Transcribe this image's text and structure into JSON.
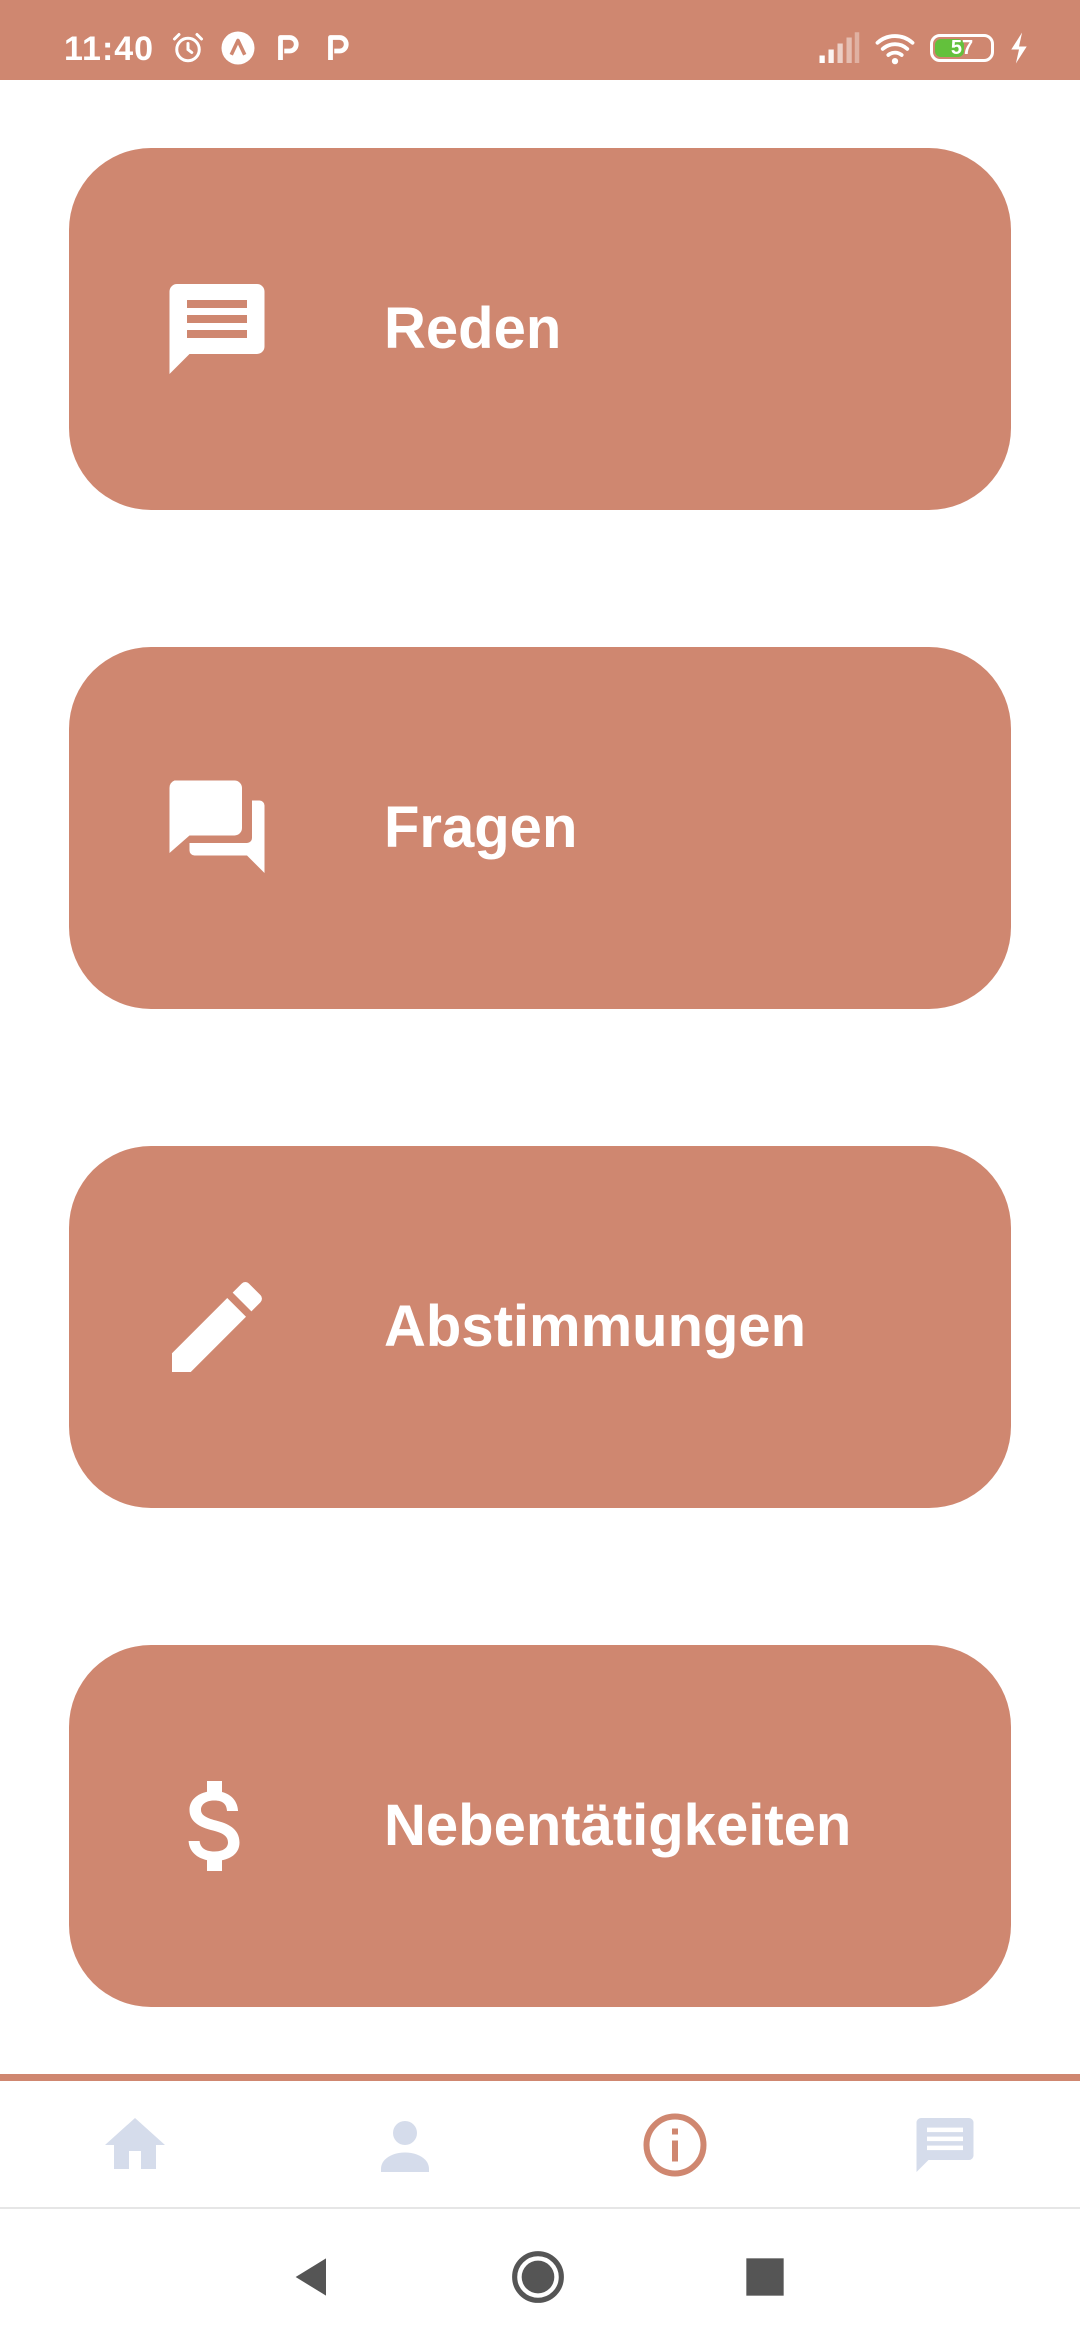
{
  "status_bar": {
    "time": "11:40",
    "battery_level": "57",
    "battery_fraction": 0.57,
    "left_icons": [
      "alarm-icon",
      "a-circle-icon",
      "p-icon",
      "p-icon"
    ],
    "right_icons": [
      "signal-icon",
      "wifi-icon",
      "battery-icon",
      "charging-icon"
    ]
  },
  "cards": [
    {
      "label": "Reden",
      "icon": "message-icon"
    },
    {
      "label": "Fragen",
      "icon": "forum-icon"
    },
    {
      "label": "Abstimmungen",
      "icon": "pencil-icon"
    },
    {
      "label": "Nebentätigkeiten",
      "icon": "dollar-icon"
    }
  ],
  "bottom_nav": {
    "items": [
      {
        "icon": "home-icon",
        "active": false
      },
      {
        "icon": "person-icon",
        "active": false
      },
      {
        "icon": "info-icon",
        "active": true
      },
      {
        "icon": "message-icon",
        "active": false
      }
    ]
  },
  "system_nav": [
    "back-icon",
    "home-circle-icon",
    "recents-icon"
  ],
  "colors": {
    "accent": "#CF8770",
    "inactive_icon": "#D5DCEB",
    "white": "#FFFFFF",
    "battery_fill": "#63C13C"
  }
}
